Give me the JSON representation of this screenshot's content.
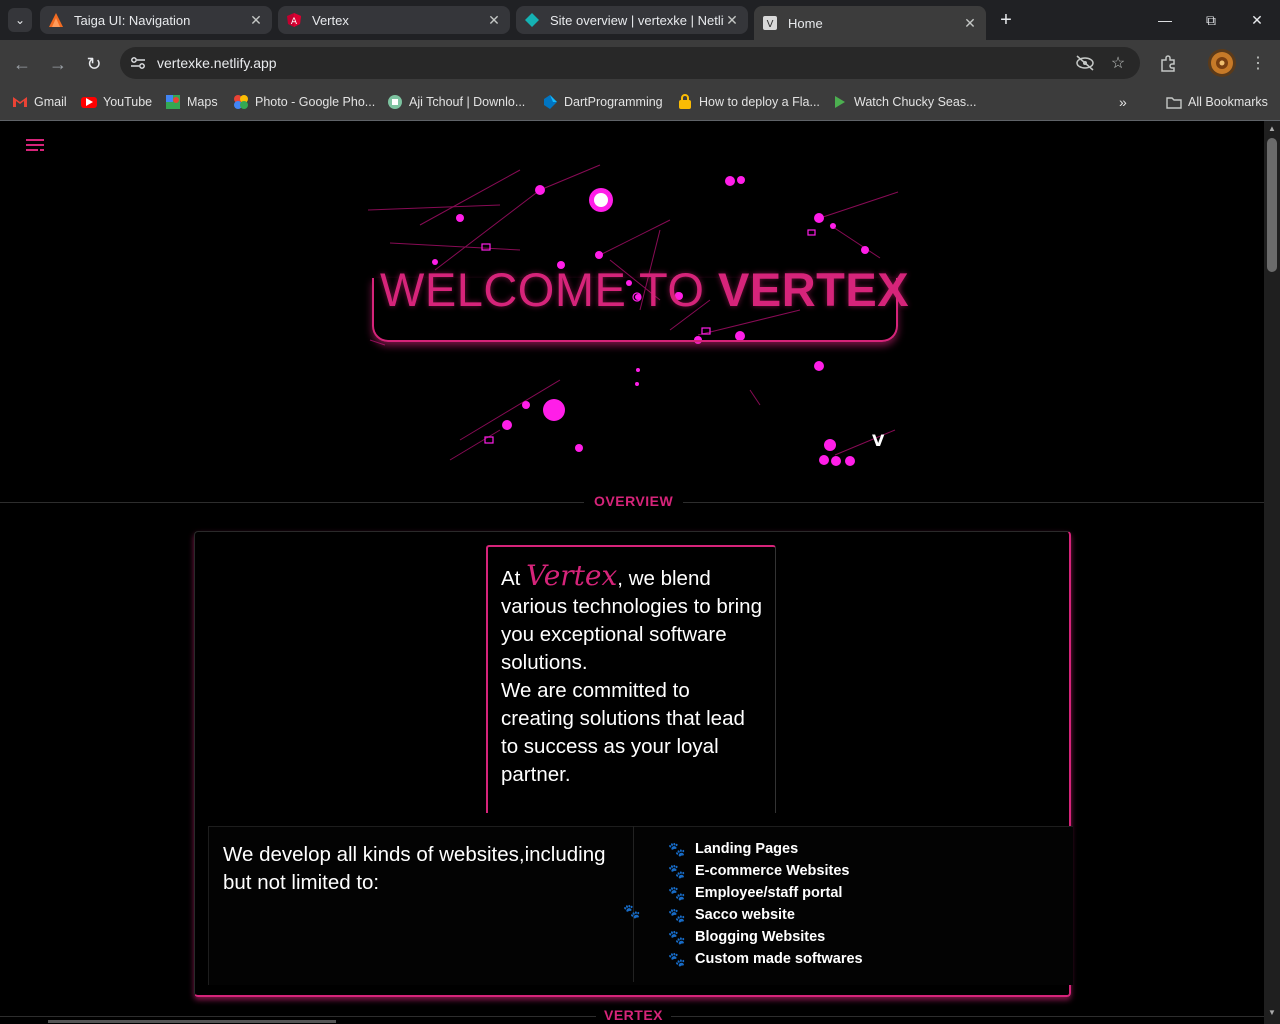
{
  "browser": {
    "tabs": [
      {
        "title": "Taiga UI: Navigation",
        "icon": "taiga-logo-icon"
      },
      {
        "title": "Vertex",
        "icon": "angular-logo-icon"
      },
      {
        "title": "Site overview | vertexke | Netlify",
        "icon": "netlify-logo-icon"
      },
      {
        "title": "Home",
        "icon": "vertex-favicon-icon"
      }
    ],
    "active_tab_index": 3,
    "url": "vertexke.netlify.app",
    "bookmarks": [
      {
        "label": "Gmail",
        "icon": "gmail-icon"
      },
      {
        "label": "YouTube",
        "icon": "youtube-icon"
      },
      {
        "label": "Maps",
        "icon": "maps-icon"
      },
      {
        "label": "Photo - Google Pho...",
        "icon": "google-photos-icon"
      },
      {
        "label": "Aji Tchouf | Downlo...",
        "icon": "site-icon"
      },
      {
        "label": "DartProgramming",
        "icon": "dart-icon"
      },
      {
        "label": "How to deploy a Fla...",
        "icon": "folder-lock-icon"
      },
      {
        "label": "Watch Chucky Seas...",
        "icon": "play-icon"
      }
    ],
    "all_bookmarks_label": "All Bookmarks"
  },
  "hero": {
    "welcome_light": "WELCOME TO ",
    "welcome_bold": "VERTEX"
  },
  "overview": {
    "section_title": "OVERVIEW",
    "intro_prefix": "At ",
    "intro_brand": "Vertex",
    "intro_rest": ", we blend various technologies to bring you exceptional software solutions.",
    "intro_commitment": "We are committed to creating solutions that lead to success as your loyal partner.",
    "develop_text": "We develop all kinds of websites,including but not limited to:",
    "services": [
      "Landing Pages",
      "E-commerce Websites",
      "Employee/staff portal",
      "Sacco website",
      "Blogging Websites",
      "Custom made softwares"
    ]
  },
  "next_section_title": "VERTEX",
  "colors": {
    "accent": "#d6247a",
    "particle": "#ff1ee8",
    "background": "#000000"
  }
}
